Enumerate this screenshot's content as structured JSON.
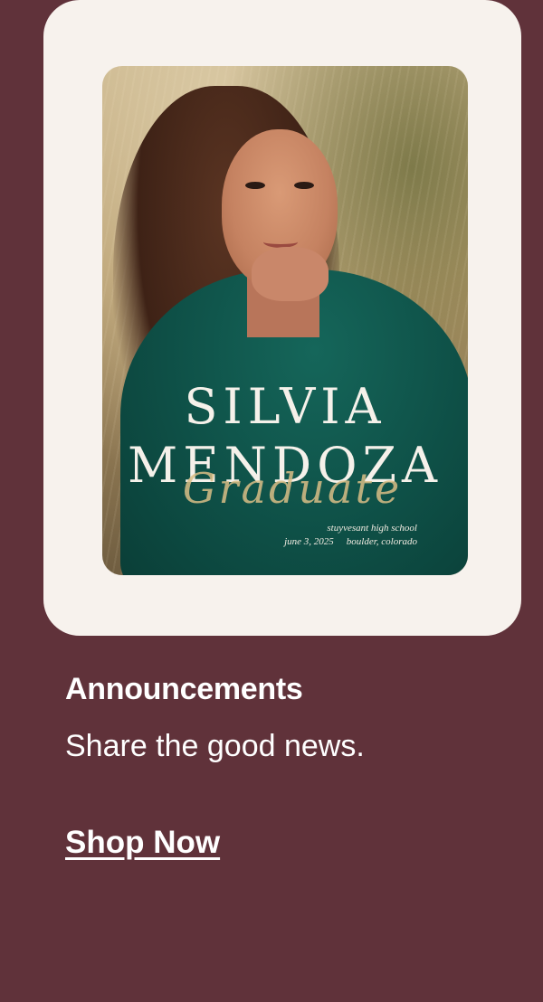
{
  "card": {
    "name_first": "SILVIA",
    "name_last": "MENDOZA",
    "script_word": "Graduate",
    "school": "stuyvesant high school",
    "date": "june 3, 2025",
    "location": "boulder, colorado"
  },
  "promo": {
    "title": "Announcements",
    "subtitle": "Share the good news.",
    "cta_label": "Shop Now"
  },
  "colors": {
    "background": "#60323a",
    "card_frame": "#f7f2ed",
    "text": "#ffffff"
  }
}
